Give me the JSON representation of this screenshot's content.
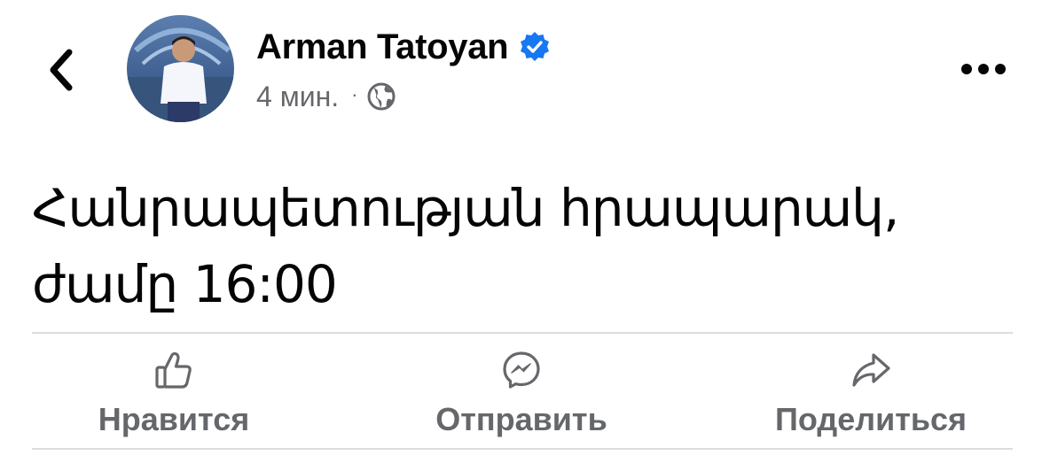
{
  "header": {
    "author_name": "Arman Tatoyan",
    "timestamp": "4 мин.",
    "separator": "·",
    "privacy_icon": "globe-icon",
    "verified_icon": "verified-badge-icon",
    "back_icon": "chevron-left-icon",
    "more_icon": "more-dots-icon",
    "badge_color": "#1877f2"
  },
  "post": {
    "line1": "Հանրապետության հրապարակ,",
    "line2": "ժամը 16:00"
  },
  "actions": [
    {
      "label": "Нравится",
      "icon": "like-icon"
    },
    {
      "label": "Отправить",
      "icon": "messenger-icon"
    },
    {
      "label": "Поделиться",
      "icon": "share-icon"
    }
  ],
  "colors": {
    "secondary_text": "#65676b",
    "divider": "#dadde1",
    "primary_text": "#050505"
  }
}
